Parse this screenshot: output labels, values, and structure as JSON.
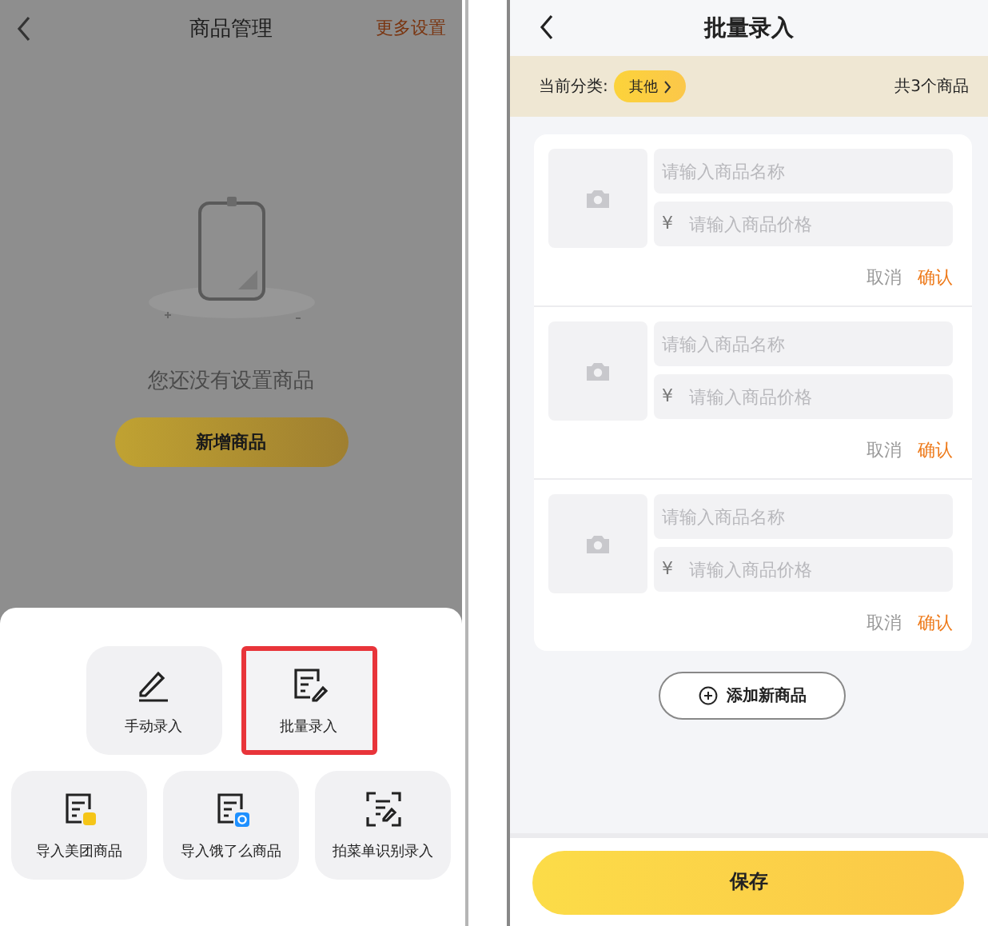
{
  "left_screen": {
    "header": {
      "title": "商品管理",
      "action": "更多设置"
    },
    "empty_state": {
      "message": "您还没有设置商品",
      "button": "新增商品"
    },
    "sheet": {
      "rows": [
        [
          {
            "label": "手动录入",
            "highlighted": false
          },
          {
            "label": "批量录入",
            "highlighted": true
          }
        ],
        [
          {
            "label": "导入美团商品",
            "highlighted": false
          },
          {
            "label": "导入饿了么商品",
            "highlighted": false
          },
          {
            "label": "拍菜单识别录入",
            "highlighted": false
          }
        ]
      ]
    }
  },
  "right_screen": {
    "header": {
      "title": "批量录入"
    },
    "category_bar": {
      "label": "当前分类:",
      "chip": "其他",
      "count": "共3个商品"
    },
    "items": [
      {
        "name_placeholder": "请输入商品名称",
        "currency": "¥",
        "price_placeholder": "请输入商品价格",
        "cancel": "取消",
        "confirm": "确认"
      },
      {
        "name_placeholder": "请输入商品名称",
        "currency": "¥",
        "price_placeholder": "请输入商品价格",
        "cancel": "取消",
        "confirm": "确认"
      },
      {
        "name_placeholder": "请输入商品名称",
        "currency": "¥",
        "price_placeholder": "请输入商品价格",
        "cancel": "取消",
        "confirm": "确认"
      }
    ],
    "add_button": "添加新商品",
    "save_button": "保存"
  }
}
